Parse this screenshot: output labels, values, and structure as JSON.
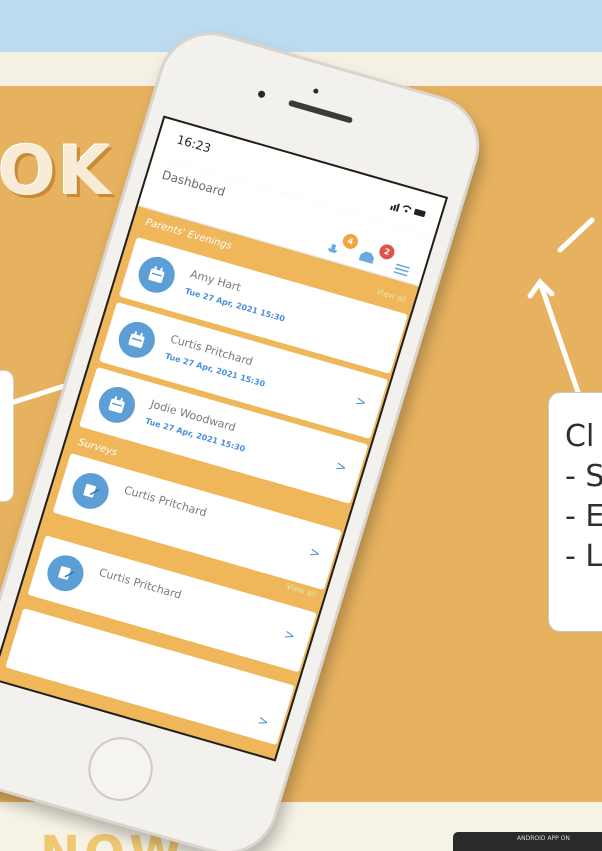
{
  "flyer": {
    "headline": "OK",
    "bottom_word": "NOW",
    "store_badge": "ANDROID APP ON",
    "callout_right": {
      "line1": "Cl",
      "line2": "- S",
      "line3": "- E",
      "line4": "- L"
    }
  },
  "phone": {
    "status_time": "16:23",
    "app_title": "Dashboard",
    "header_badges": {
      "orange_count": "4",
      "red_count": "2"
    },
    "sections": [
      {
        "title": "Parents' Evenings",
        "view_all": "View all",
        "items": [
          {
            "name": "Amy Hart",
            "datetime": "Tue 27 Apr, 2021 15:30"
          },
          {
            "name": "Curtis Pritchard",
            "datetime": "Tue 27 Apr, 2021 15:30"
          },
          {
            "name": "Jodie Woodward",
            "datetime": "Tue 27 Apr, 2021 15:30"
          }
        ]
      },
      {
        "title": "Surveys",
        "view_all": "View all",
        "items": [
          {
            "name": "Curtis Pritchard",
            "subtitle": ""
          },
          {
            "name": "Curtis Pritchard",
            "subtitle": ""
          }
        ]
      }
    ],
    "chevron": ">"
  },
  "colors": {
    "mustard": "#e6b25f",
    "screen_bg": "#efb65a",
    "accent_blue": "#5b9fd6",
    "badge_orange": "#f0a640",
    "badge_red": "#e0554a",
    "sky": "#bcdbee"
  }
}
